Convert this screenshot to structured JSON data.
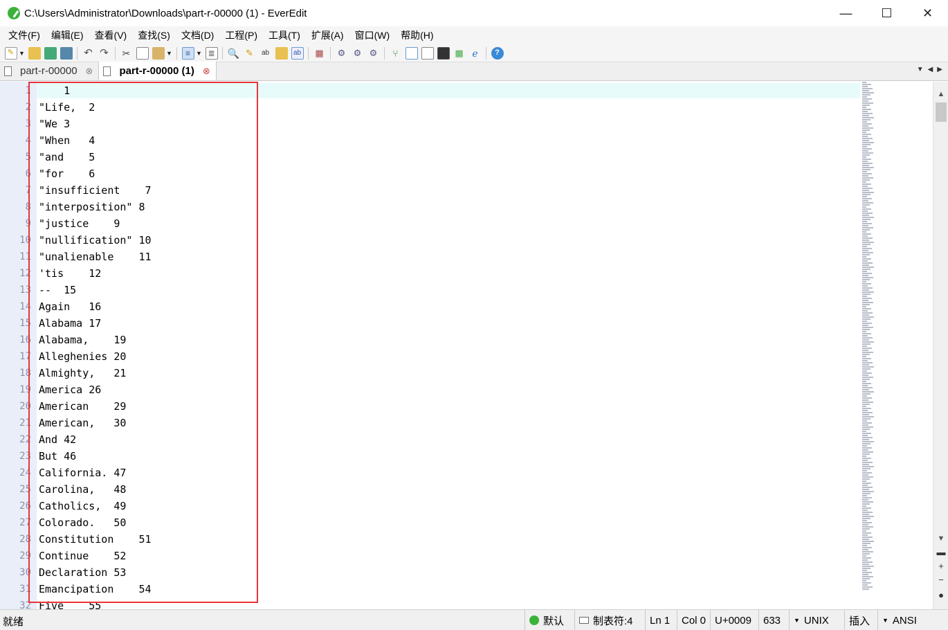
{
  "window": {
    "title": "C:\\Users\\Administrator\\Downloads\\part-r-00000 (1) - EverEdit",
    "minimize": "—",
    "maximize": "☐",
    "close": "✕"
  },
  "menu": [
    "文件(F)",
    "编辑(E)",
    "查看(V)",
    "查找(S)",
    "文档(D)",
    "工程(P)",
    "工具(T)",
    "扩展(A)",
    "窗口(W)",
    "帮助(H)"
  ],
  "tabs": [
    {
      "label": "part-r-00000",
      "close": "⊗"
    },
    {
      "label": "part-r-00000 (1)",
      "close": "⊗"
    }
  ],
  "editor": {
    "lines": [
      "    1",
      "\"Life,  2",
      "\"We 3",
      "\"When   4",
      "\"and    5",
      "\"for    6",
      "\"insufficient    7",
      "\"interposition\" 8",
      "\"justice    9",
      "\"nullification\" 10",
      "\"unalienable    11",
      "'tis    12",
      "--  15",
      "Again   16",
      "Alabama 17",
      "Alabama,    19",
      "Alleghenies 20",
      "Almighty,   21",
      "America 26",
      "American    29",
      "American,   30",
      "And 42",
      "But 46",
      "California. 47",
      "Carolina,   48",
      "Catholics,  49",
      "Colorado.   50",
      "Constitution    51",
      "Continue    52",
      "Declaration 53",
      "Emancipation    54",
      "Five    55"
    ],
    "gutter": [
      "1",
      "2",
      "3",
      "4",
      "5",
      "6",
      "7",
      "8",
      "9",
      "10",
      "11",
      "12",
      "13",
      "14",
      "15",
      "16",
      "17",
      "18",
      "19",
      "20",
      "21",
      "22",
      "23",
      "24",
      "25",
      "26",
      "27",
      "28",
      "29",
      "30",
      "31",
      "32"
    ]
  },
  "status": {
    "ready": "就绪",
    "mode": "默认",
    "tab_size": "制表符:4",
    "line": "Ln 1",
    "col": "Col 0",
    "unicode": "U+0009",
    "count": "633",
    "eol": "UNIX",
    "insert": "插入",
    "encoding": "ANSI"
  }
}
